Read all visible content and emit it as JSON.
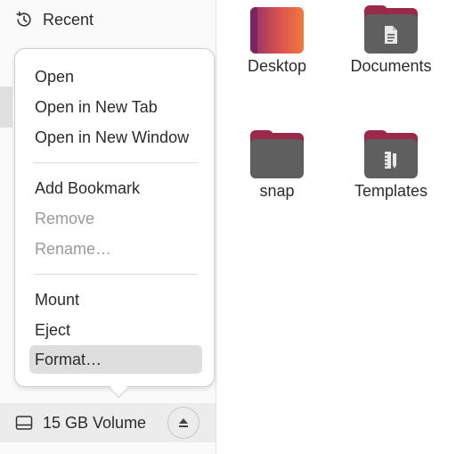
{
  "sidebar": {
    "recent_label": "Recent",
    "recent_icon": "history-icon",
    "volume_label": "15 GB Volume",
    "volume_icon": "drive-icon",
    "eject_icon": "eject-icon"
  },
  "context_menu": {
    "open": "Open",
    "open_new_tab": "Open in New Tab",
    "open_new_window": "Open in New Window",
    "add_bookmark": "Add Bookmark",
    "remove": "Remove",
    "rename": "Rename…",
    "mount": "Mount",
    "eject": "Eject",
    "format": "Format…"
  },
  "files": [
    {
      "name": "Desktop",
      "type": "desktop-folder"
    },
    {
      "name": "Documents",
      "type": "documents-folder"
    },
    {
      "name": "snap",
      "type": "folder"
    },
    {
      "name": "Templates",
      "type": "templates-folder"
    }
  ],
  "colors": {
    "folder_gray": "#5f5f5f",
    "folder_tab": "#9b2a4a",
    "desktop_gradient_start": "#8f2d6f",
    "desktop_gradient_end": "#f07a3e"
  }
}
